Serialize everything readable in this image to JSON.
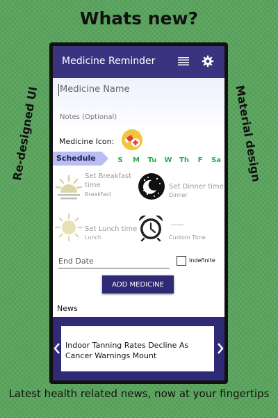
{
  "promo": {
    "headline": "Whats new?",
    "left_badge": "Re-designed UI",
    "right_badge": "Material design",
    "caption": "Latest health related news, now at your fingertips"
  },
  "app": {
    "title": "Medicine Reminder",
    "icons": {
      "menu": "list-menu-icon",
      "settings": "gear-icon"
    },
    "colors": {
      "primary": "#3a3480",
      "accent": "#22b14c",
      "schedule_tag": "#b9bdf0",
      "pill": "#f2c53d"
    }
  },
  "form": {
    "name_placeholder": "Medicine Name",
    "notes_placeholder": "Notes (Optional)",
    "icon_label": "Medicine Icon:",
    "schedule_label": "Schedule",
    "days": [
      "S",
      "M",
      "Tu",
      "W",
      "Th",
      "F",
      "Sa"
    ],
    "alarms": [
      {
        "title": "Set Breakfast time",
        "subtitle": "Breakfast",
        "icon": "sunrise-icon"
      },
      {
        "title": "Set Dinner time",
        "subtitle": "Dinner",
        "icon": "moon-night-icon"
      },
      {
        "title": "Set Lunch time",
        "subtitle": "Lunch",
        "icon": "sun-icon"
      },
      {
        "title": "-----",
        "subtitle": "Custom Time",
        "icon": "alarm-clock-icon"
      }
    ],
    "end_date_placeholder": "End Date",
    "indefinite_label": "Indefinite",
    "indefinite_checked": false,
    "add_button": "ADD MEDICINE"
  },
  "news": {
    "section_label": "News",
    "headline": "Indoor Tanning Rates Decline As Cancer Warnings Mount"
  }
}
